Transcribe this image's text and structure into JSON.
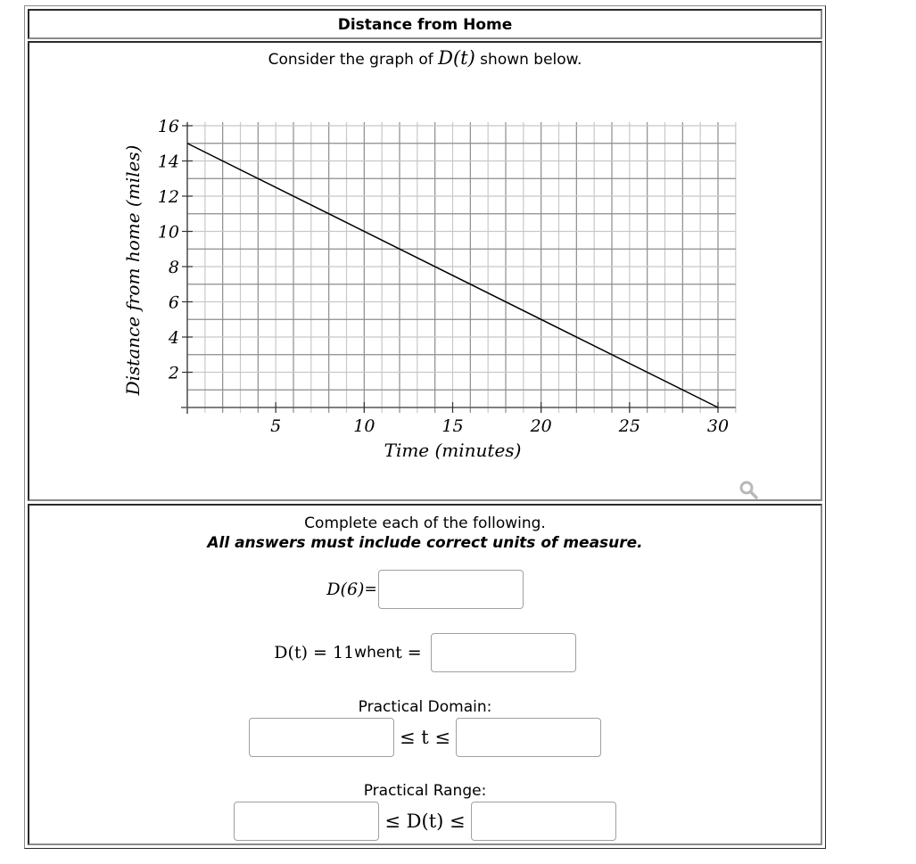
{
  "title": "Distance from Home",
  "intro": {
    "prefix": "Consider the graph of ",
    "math": "D(t)",
    "suffix": " shown below."
  },
  "magnifier_icon": "magnifier-icon",
  "chart_data": {
    "type": "line",
    "title": "",
    "xlabel": "Time (minutes)",
    "ylabel": "Distance from home (miles)",
    "xlim": [
      0,
      31
    ],
    "ylim": [
      0,
      16
    ],
    "x_ticks": [
      5,
      10,
      15,
      20,
      25,
      30
    ],
    "y_ticks": [
      2,
      4,
      6,
      8,
      10,
      12,
      14,
      16
    ],
    "grid": true,
    "grid_step_x": 1,
    "grid_step_y": 1,
    "series": [
      {
        "name": "D(t)",
        "x": [
          0,
          30
        ],
        "y": [
          15,
          0
        ],
        "color": "#000000"
      }
    ]
  },
  "form": {
    "lead": "Complete each of the following.",
    "warning": "All answers must include correct units of measure.",
    "q1": {
      "label": "D(6)",
      "eq": "=",
      "value": ""
    },
    "q2": {
      "prefix_math": "D(t) = 11",
      "when": " when ",
      "t_eq": "t =",
      "value": ""
    },
    "domain": {
      "label": "Practical Domain:",
      "middle": "≤ t ≤",
      "low_value": "",
      "high_value": ""
    },
    "range": {
      "label": "Practical Range:",
      "middle": "≤ D(t) ≤",
      "low_value": "",
      "high_value": ""
    }
  }
}
